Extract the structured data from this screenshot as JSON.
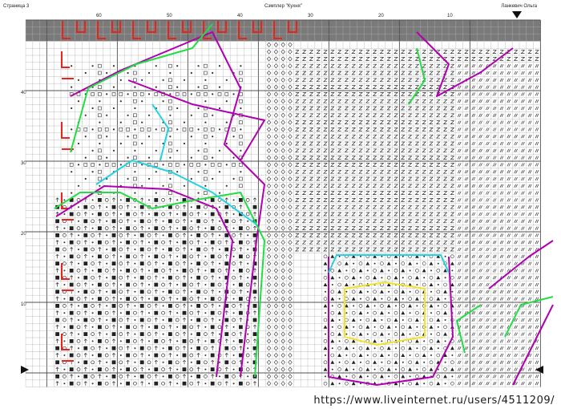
{
  "header": {
    "page_label": "Страница 3",
    "title": "Сэмплер \"Кухня\"",
    "author": "Ланкевич Ольга"
  },
  "column_numbers": [
    "60",
    "50",
    "40",
    "30",
    "20",
    "10"
  ],
  "row_numbers": [
    "40",
    "30",
    "20",
    "10"
  ],
  "watermark": "https://www.liveinternet.ru/users/4511209/",
  "colors": {
    "grid": "#b0b0b0",
    "grid_major": "#505050",
    "header_band": "#7a7a7a",
    "border_red": "#e8241c",
    "outline_purple": "#b000b0",
    "outline_green": "#22dd44",
    "outline_cyan": "#22d4e0",
    "outline_yellow": "#f2e22a"
  },
  "icons": [
    "arrow-right-marker",
    "arrow-left-marker",
    "arrow-down-marker"
  ]
}
